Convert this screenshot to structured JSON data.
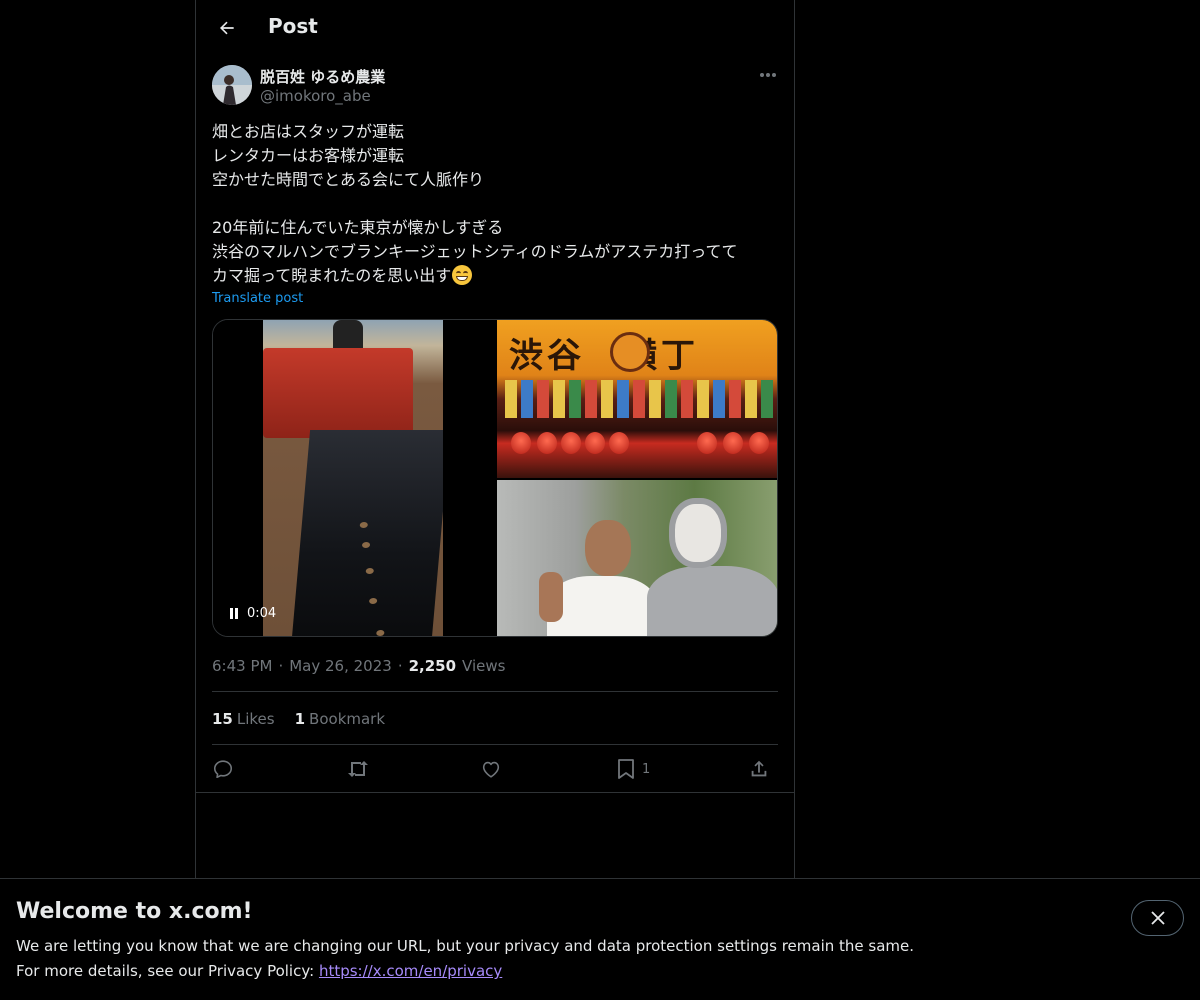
{
  "header": {
    "title": "Post"
  },
  "author": {
    "name": "脱百姓 ゆるめ農業",
    "handle": "@imokoro_abe"
  },
  "post": {
    "text": "畑とお店はスタッフが運転\nレンタカーはお客様が運転\n空かせた時間でとある会にて人脈作り\n\n20年前に住んでいた東京が懐かしすぎる\n渋谷のマルハンでブランキージェットシティのドラムがアステカ打ってて\nカマ掘って睨まれたのを思い出す",
    "emoji": "grinning-face-with-smiling-eyes",
    "translate_label": "Translate post"
  },
  "media": {
    "video_time": "0:04",
    "sign_text": "渋谷 横丁"
  },
  "meta": {
    "time": "6:43 PM",
    "separator": "·",
    "date": "May 26, 2023",
    "views_count": "2,250",
    "views_label": "Views"
  },
  "stats": {
    "likes_count": "15",
    "likes_label": "Likes",
    "bookmarks_count": "1",
    "bookmarks_label": "Bookmark"
  },
  "actions": {
    "bookmark_count": "1"
  },
  "cookie_banner": {
    "title": "Welcome to x.com!",
    "line1": "We are letting you know that we are changing our URL, but your privacy and data protection settings remain the same.",
    "line2_prefix": "For more details, see our Privacy Policy: ",
    "link_text": "https://x.com/en/privacy"
  },
  "colors": {
    "background": "#000000",
    "text": "#e7e9ea",
    "muted": "#71767b",
    "link": "#1d9bf0",
    "border": "#2f3336",
    "banner_link": "#a78bfa"
  }
}
